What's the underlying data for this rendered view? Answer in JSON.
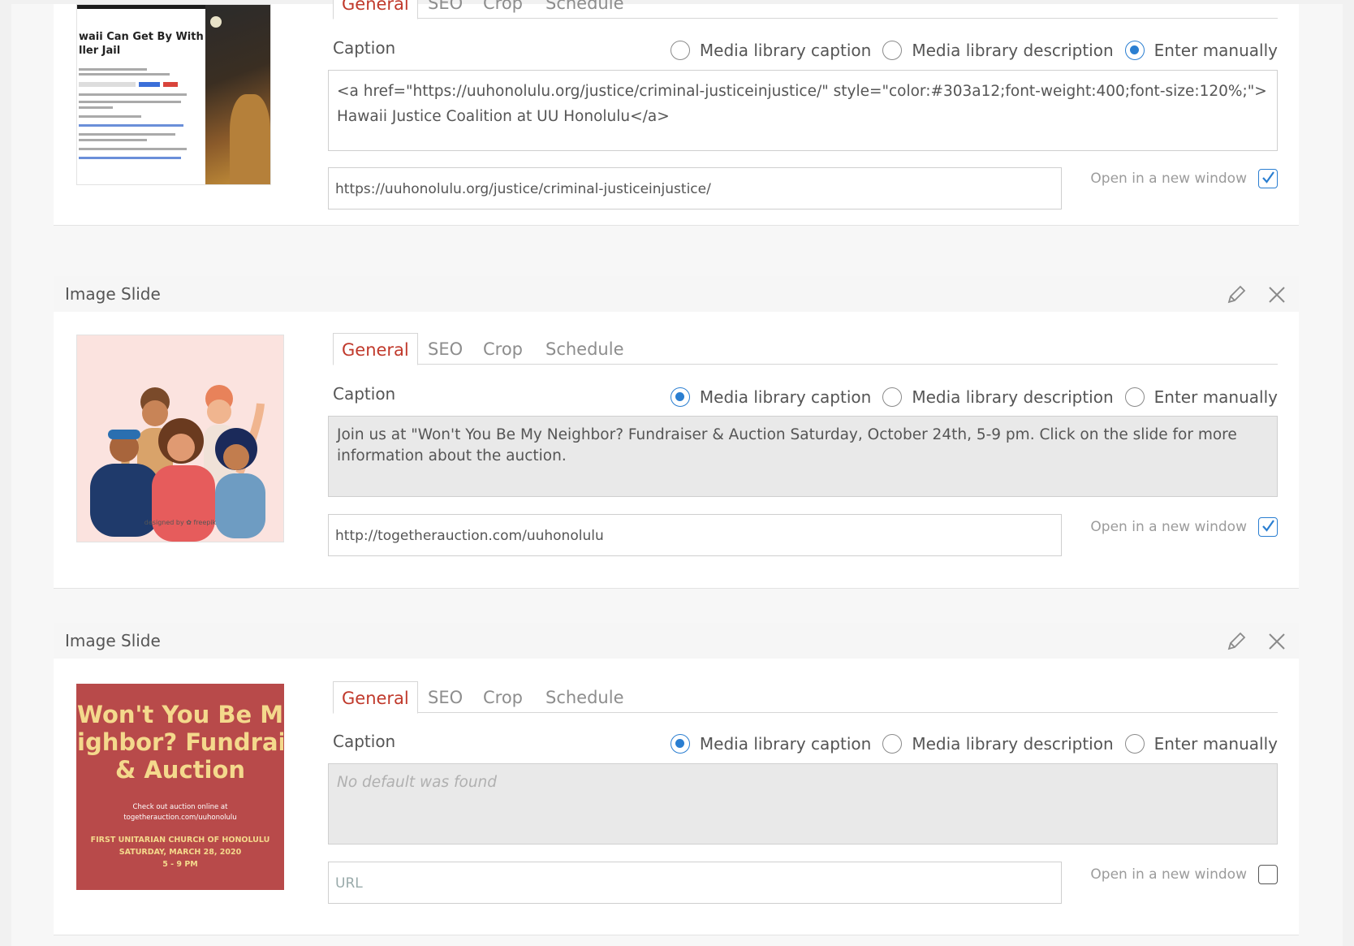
{
  "tab_labels": {
    "general": "General",
    "seo": "SEO",
    "crop": "Crop",
    "schedule": "Schedule"
  },
  "caption_label": "Caption",
  "radio_labels": {
    "media_caption": "Media library caption",
    "media_description": "Media library description",
    "manual": "Enter manually"
  },
  "new_window_label": "Open in a new window",
  "slides": [
    {
      "caption_text": "<a href=\"https://uuhonolulu.org/justice/criminal-justiceinjustice/\" style=\"color:#303a12;font-weight:400;font-size:120%;\">Hawaii Justice Coalition at UU Honolulu</a>",
      "caption_mode": "manual",
      "url_value": "https://uuhonolulu.org/justice/criminal-justiceinjustice/",
      "new_window": true,
      "thumb_text": {
        "headline": "waii Can Get By With\nller Jail"
      }
    },
    {
      "title": "Image Slide",
      "caption_text": "Join us at \"Won't You Be My Neighbor? Fundraiser & Auction Saturday, October 24th, 5-9 pm. Click on the slide for more information about the auction.",
      "caption_mode": "media_caption",
      "url_value": "http://togetherauction.com/uuhonolulu",
      "new_window": true,
      "thumb_text": {
        "credit": "designed by ✿ freepik"
      }
    },
    {
      "title": "Image Slide",
      "caption_placeholder": "No default was found",
      "caption_mode": "media_caption",
      "url_placeholder": "URL",
      "new_window": false,
      "thumb_text": {
        "line1": "Won't You Be My",
        "line2": "ighbor? Fundrai",
        "line3": "& Auction",
        "line4": "Check out auction online at",
        "line5": "togetherauction.com/uuhonolulu",
        "line6": "FIRST UNITARIAN CHURCH OF HONOLULU",
        "line7": "SATURDAY, MARCH 28, 2020",
        "line8": "5 - 9 PM"
      }
    }
  ],
  "colors": {
    "accent": "#2a7ed1",
    "active_tab": "#c0392b",
    "thumb3_bg": "#b84a4a",
    "thumb3_text": "#f4d98c"
  },
  "icons": {
    "edit": "pencil-icon",
    "remove": "close-icon",
    "checked": "checkmark-icon"
  }
}
